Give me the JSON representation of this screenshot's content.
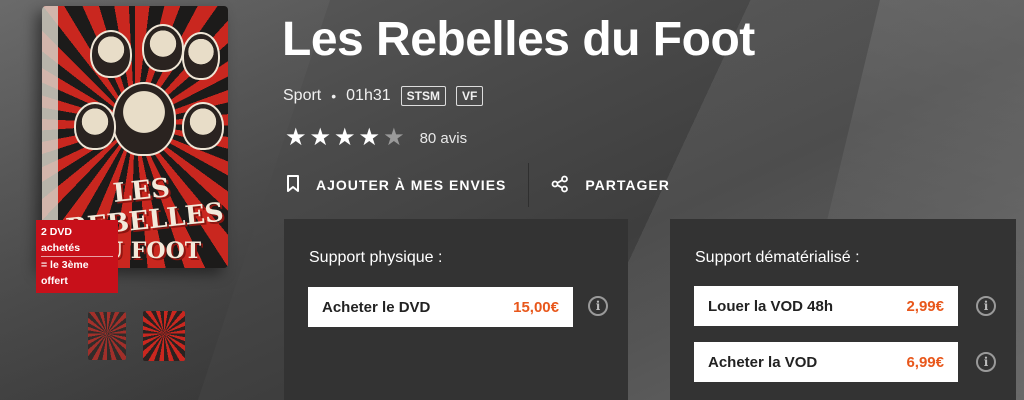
{
  "product": {
    "title": "Les Rebelles du Foot",
    "genre": "Sport",
    "separator": "•",
    "duration": "01h31",
    "tags": [
      "STSM",
      "VF"
    ],
    "rating": 4,
    "rating_max": 5,
    "reviews": "80 avis"
  },
  "cover": {
    "title_line1": "LES REBELLES",
    "title_line2": "DU FOOT",
    "promo_line1": "2 DVD achetés",
    "promo_line2": "= le 3ème offert"
  },
  "actions": {
    "wishlist": "AJOUTER À MES ENVIES",
    "share": "PARTAGER"
  },
  "physical": {
    "title": "Support physique :",
    "offers": [
      {
        "label": "Acheter le DVD",
        "price": "15,00€"
      }
    ]
  },
  "digital": {
    "title": "Support dématérialisé :",
    "offers": [
      {
        "label": "Louer la VOD 48h",
        "price": "2,99€"
      },
      {
        "label": "Acheter la VOD",
        "price": "6,99€"
      }
    ]
  },
  "colors": {
    "accent_price": "#e8571b",
    "promo_red": "#c8101a",
    "panel_bg": "#333333"
  },
  "icons": {
    "wishlist": "bookmark-icon",
    "share": "share-icon",
    "info": "info-icon",
    "star": "star-icon"
  }
}
